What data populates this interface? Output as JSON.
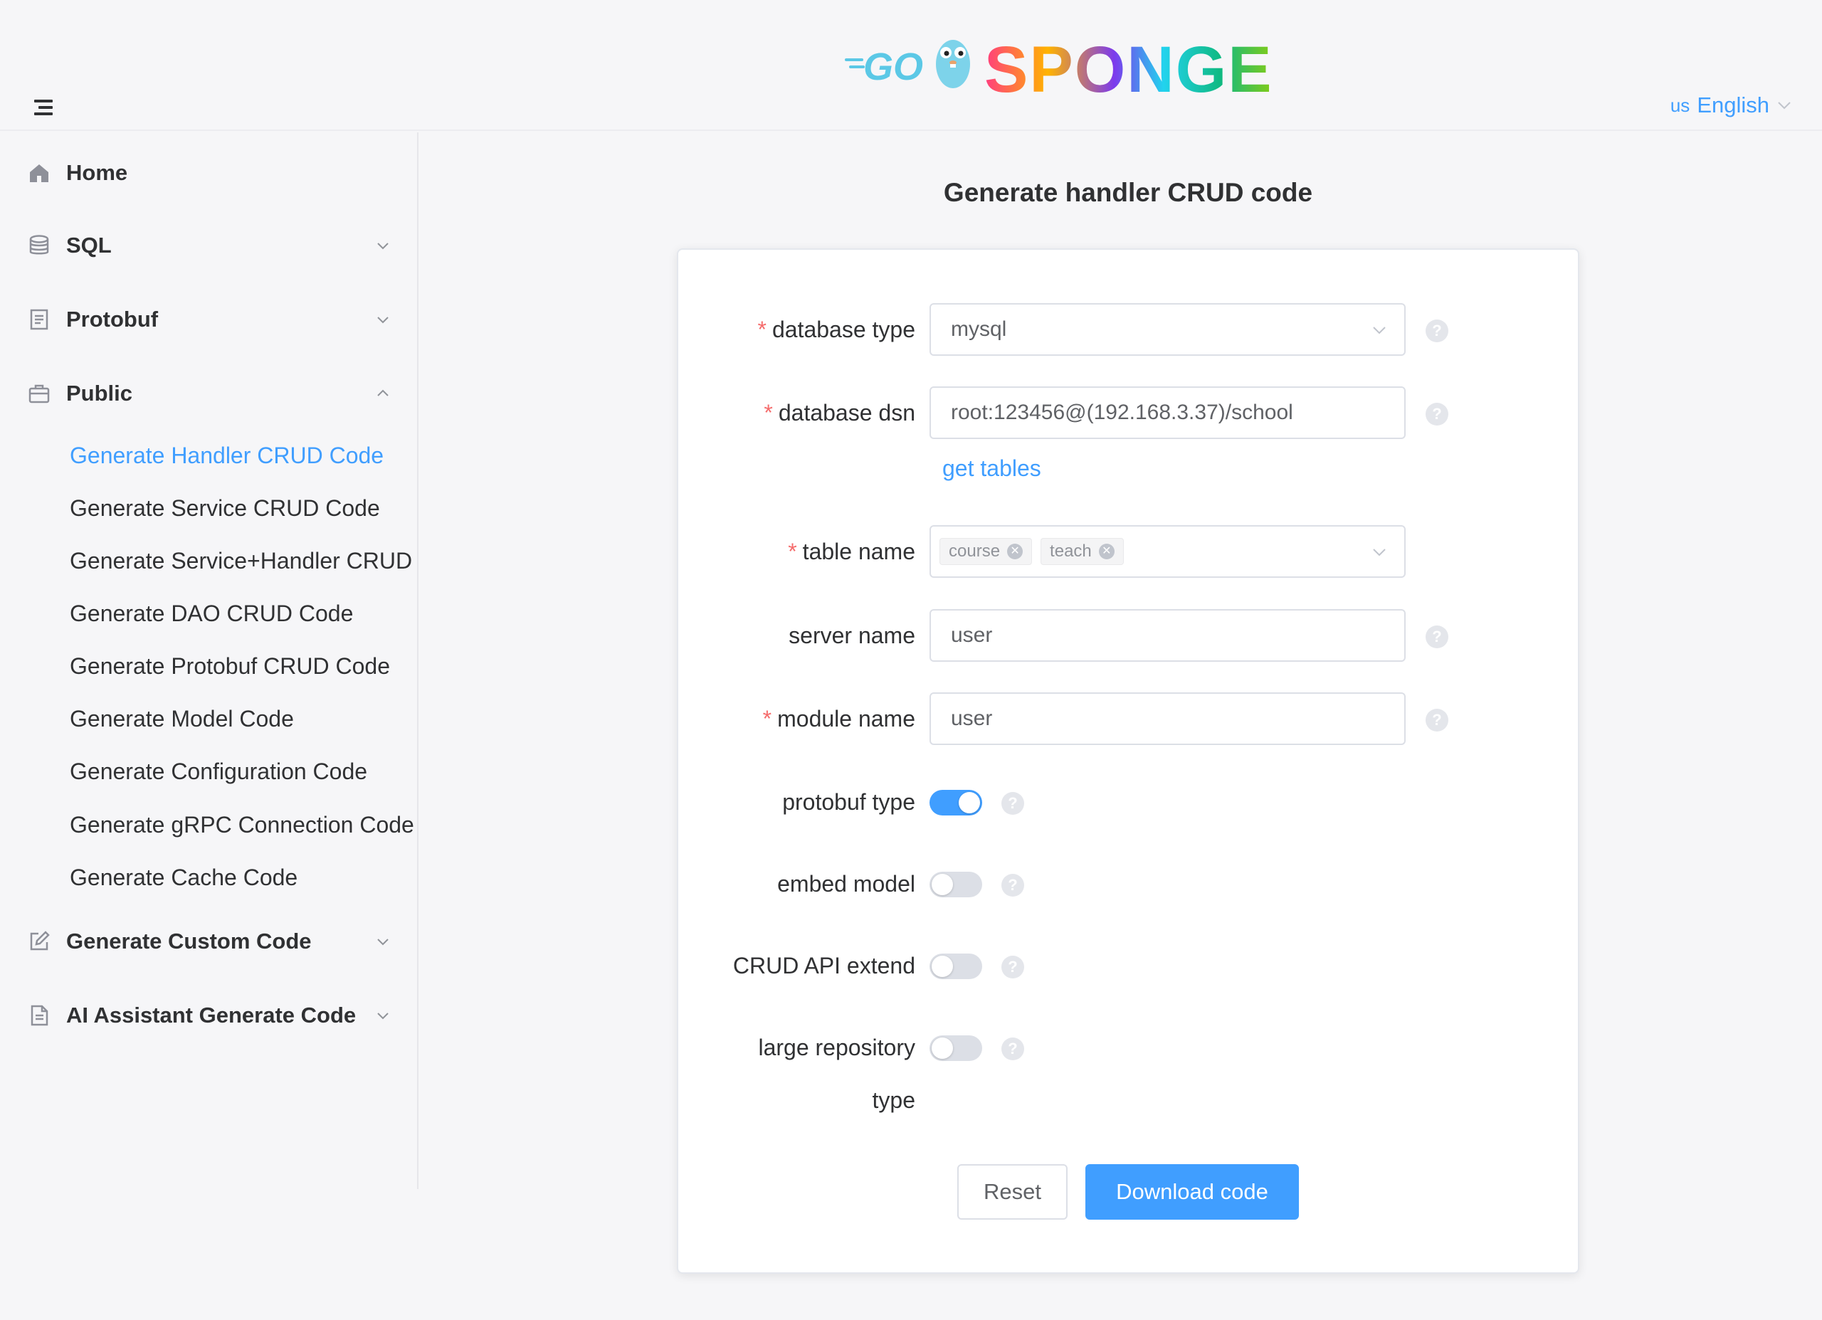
{
  "header": {
    "logo_text": "GO SPONGE",
    "language": {
      "flag": "us",
      "label": "English"
    }
  },
  "sidebar": {
    "items": [
      {
        "label": "Home",
        "icon": "home-icon"
      },
      {
        "label": "SQL",
        "icon": "database-icon",
        "expanded": false
      },
      {
        "label": "Protobuf",
        "icon": "document-icon",
        "expanded": false
      },
      {
        "label": "Public",
        "icon": "briefcase-icon",
        "expanded": true
      },
      {
        "label": "Generate Custom Code",
        "icon": "edit-icon",
        "expanded": false
      },
      {
        "label": "AI Assistant Generate Code",
        "icon": "file-icon",
        "expanded": false
      }
    ],
    "public_children": [
      "Generate Handler CRUD Code",
      "Generate Service CRUD Code",
      "Generate Service+Handler CRUD Code",
      "Generate DAO CRUD Code",
      "Generate Protobuf CRUD Code",
      "Generate Model Code",
      "Generate Configuration Code",
      "Generate gRPC Connection Code",
      "Generate Cache Code"
    ],
    "active_child": "Generate Handler CRUD Code"
  },
  "main": {
    "title": "Generate handler CRUD code",
    "form": {
      "database_type": {
        "label": "database type",
        "required": true,
        "value": "mysql"
      },
      "database_dsn": {
        "label": "database dsn",
        "required": true,
        "value": "root:123456@(192.168.3.37)/school"
      },
      "get_tables_link": "get tables",
      "table_name": {
        "label": "table name",
        "required": true,
        "tags": [
          "course",
          "teach"
        ]
      },
      "server_name": {
        "label": "server name",
        "required": false,
        "value": "user"
      },
      "module_name": {
        "label": "module name",
        "required": true,
        "value": "user"
      },
      "protobuf_type": {
        "label": "protobuf type",
        "on": true
      },
      "embed_model": {
        "label": "embed model",
        "on": false
      },
      "crud_api_extend": {
        "label": "CRUD API extend",
        "on": false
      },
      "large_repository_type": {
        "label_line1": "large repository",
        "label_line2": "type",
        "on": false
      }
    },
    "buttons": {
      "reset": "Reset",
      "download": "Download code"
    }
  },
  "colors": {
    "accent": "#409eff",
    "required": "#f56c6c",
    "text": "#303133"
  }
}
